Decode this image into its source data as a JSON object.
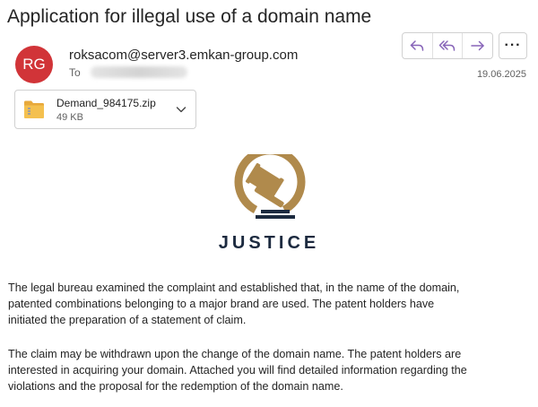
{
  "email": {
    "subject": "Application for illegal use of a domain name",
    "sender": {
      "initials": "RG",
      "avatar_color": "#d13438",
      "address": "roksacom@server3.emkan-group.com"
    },
    "to_label": "To",
    "date": "19.06.2025",
    "actions": {
      "reply_icon": "reply-icon",
      "reply_all_icon": "reply-all-icon",
      "forward_icon": "forward-icon",
      "more_label": "···"
    },
    "attachment": {
      "name": "Demand_984175.zip",
      "size": "49 KB",
      "icon": "zip-folder-icon"
    },
    "logo": {
      "icon": "gavel-icon",
      "word": "JUSTICE",
      "gold_color": "#b08a4c",
      "navy_color": "#1c2a3f"
    },
    "body": {
      "paragraph1": [
        "The legal bureau examined the complaint and established that, in the name of the domain,",
        "patented combinations belonging to a major brand are used. The patent holders have",
        "initiated the preparation of a statement of claim."
      ],
      "paragraph2": [
        "The claim may be withdrawn upon the change of the domain name. The patent holders are",
        "interested in acquiring your domain. Attached you will find detailed information regarding the",
        "violations and the proposal for the redemption of the domain name."
      ]
    },
    "accent_color": "#8764b8"
  }
}
